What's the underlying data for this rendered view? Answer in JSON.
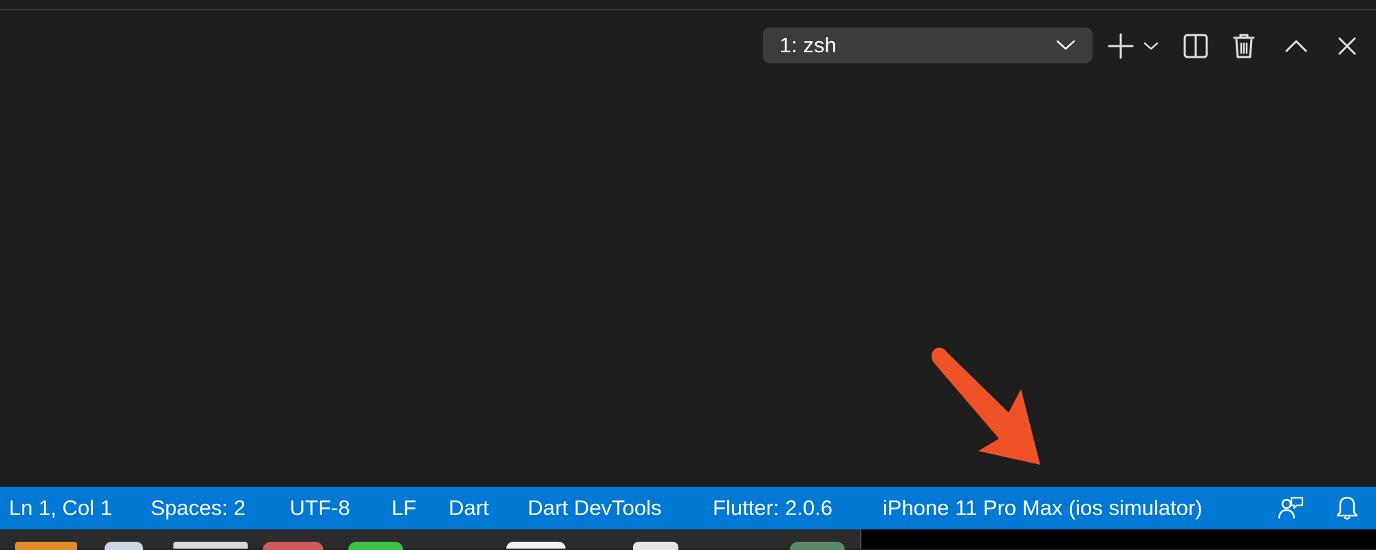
{
  "terminal": {
    "selected_shell": "1: zsh"
  },
  "toolbar_icons": [
    "new-terminal-icon",
    "chevron-down-icon",
    "split-terminal-icon",
    "trash-icon",
    "maximize-panel-icon",
    "close-panel-icon"
  ],
  "statusbar": {
    "cursor_position": "Ln 1, Col 1",
    "indentation": "Spaces: 2",
    "encoding": "UTF-8",
    "line_ending": "LF",
    "language": "Dart",
    "devtools": "Dart DevTools",
    "flutter_version": "Flutter: 2.0.6",
    "device": "iPhone 11 Pro Max (ios simulator)",
    "icons": [
      "feedback-icon",
      "bell-icon"
    ]
  },
  "colors": {
    "editor_background": "#1e1e1e",
    "statusbar_background": "#0078d4",
    "annotation_arrow": "#f05228"
  }
}
